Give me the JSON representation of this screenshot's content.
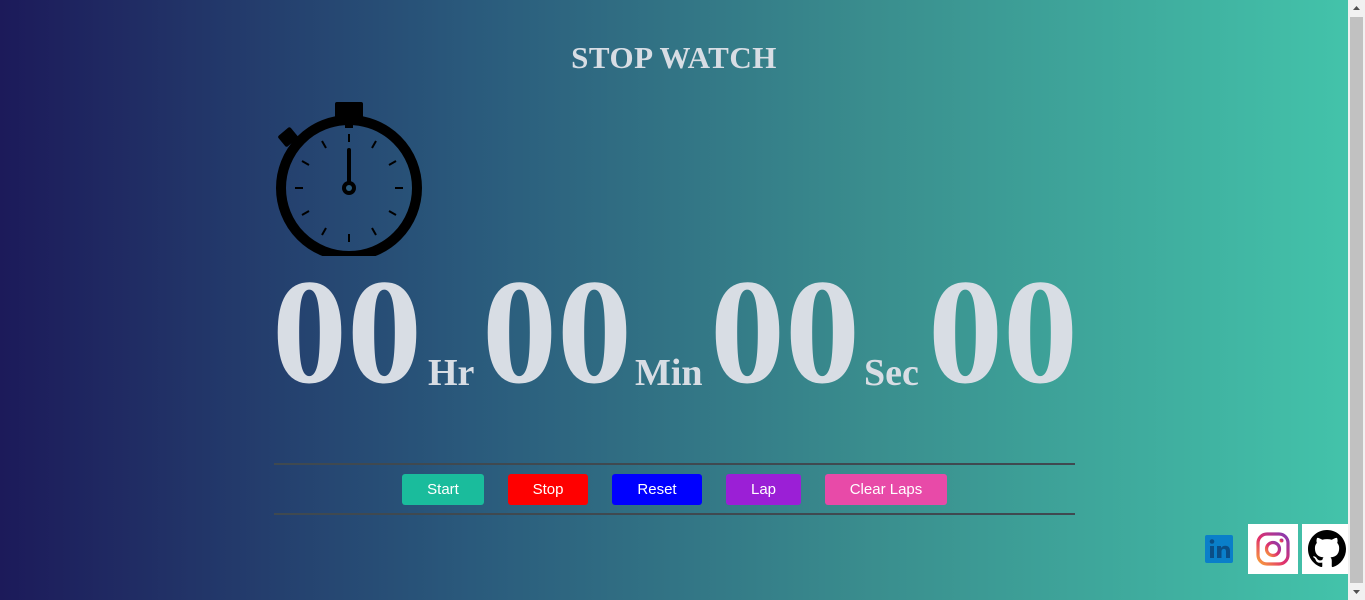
{
  "title": "STOP WATCH",
  "display": {
    "hours": "00",
    "hours_unit": "Hr",
    "minutes": "00",
    "minutes_unit": "Min",
    "seconds": "00",
    "seconds_unit": "Sec",
    "milliseconds": "00"
  },
  "buttons": {
    "start": "Start",
    "stop": "Stop",
    "reset": "Reset",
    "lap": "Lap",
    "clear_laps": "Clear Laps"
  },
  "colors": {
    "start": "#1abc9c",
    "stop": "#ff0000",
    "reset": "#0000ff",
    "lap": "#9b1fd6",
    "clear_laps": "#e84aa8"
  },
  "social": [
    "linkedin-icon",
    "instagram-icon",
    "github-icon"
  ]
}
